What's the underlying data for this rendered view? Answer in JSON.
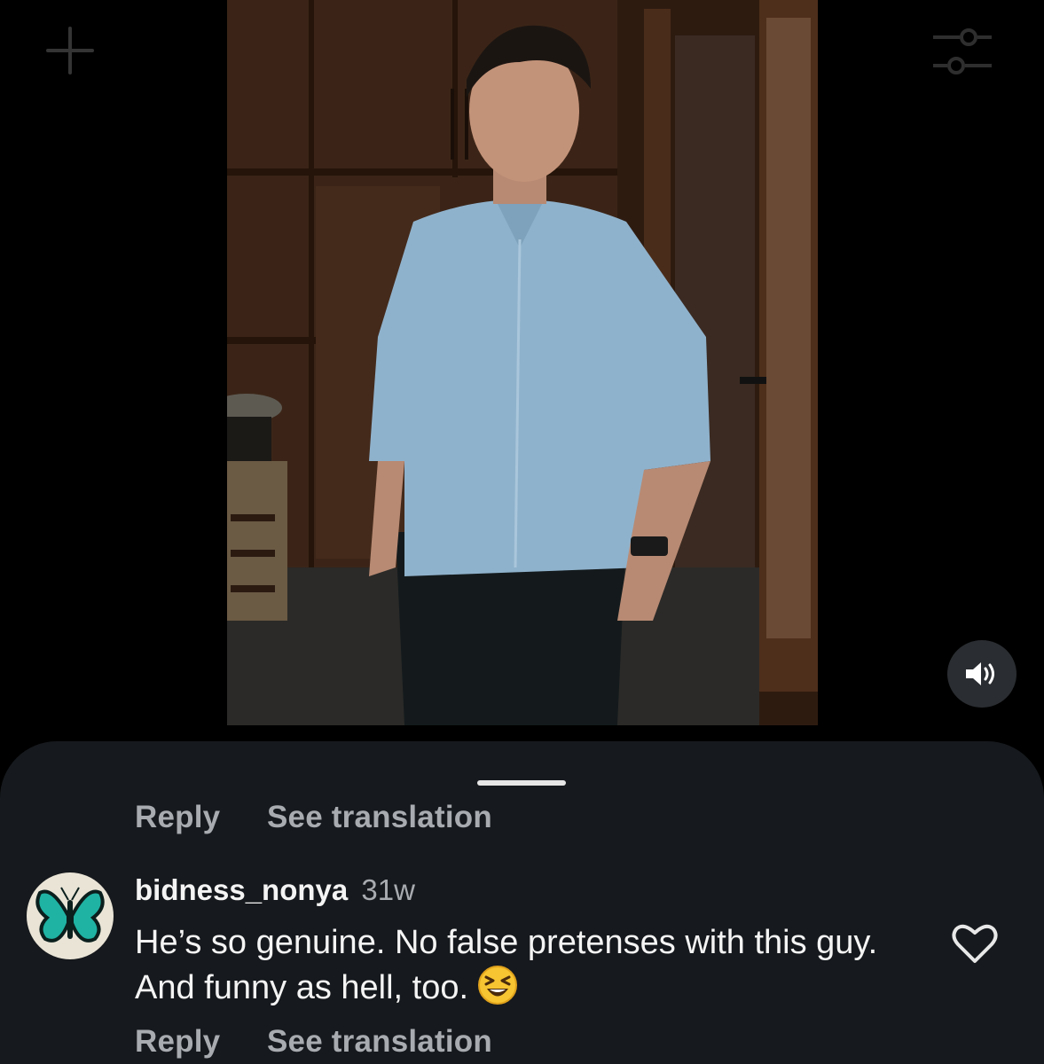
{
  "video": {
    "controls": {
      "create_icon": "plus-icon",
      "filter_icon": "filter-icon",
      "mute_icon": "speaker-icon"
    }
  },
  "comments_sheet": {
    "previous_comment": {
      "reply_label": "Reply",
      "translate_label": "See translation"
    },
    "comment": {
      "username": "bidness_nonya",
      "age": "31w",
      "text": "He’s so genuine. No false pretenses with this guy. And funny as hell, too.",
      "emoji": "grinning-squinting-face",
      "avatar_icon": "butterfly-icon",
      "reply_label": "Reply",
      "translate_label": "See translation",
      "like_icon": "heart-icon"
    }
  },
  "colors": {
    "sheet_background": "#16191d",
    "secondary_text": "#a8abb0",
    "butterfly": "#1fb3a3"
  }
}
